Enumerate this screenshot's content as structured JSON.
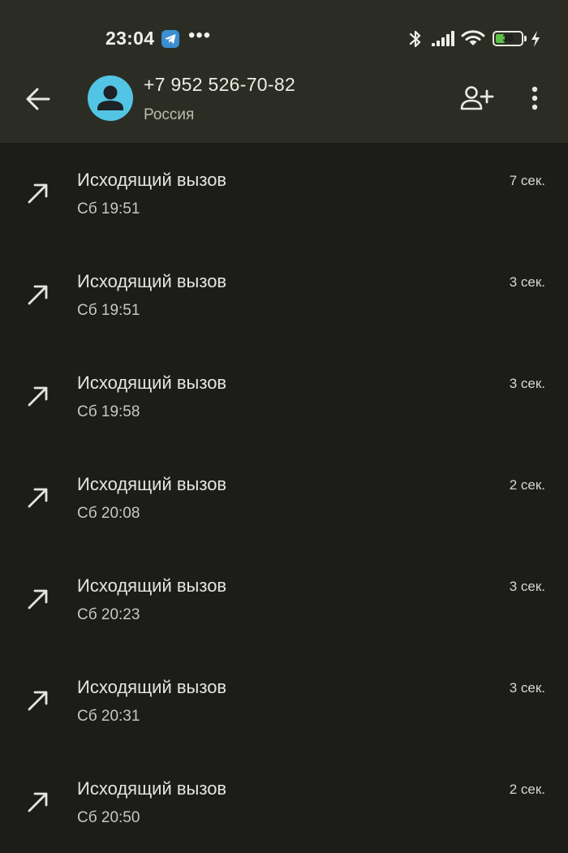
{
  "status_bar": {
    "time": "23:04",
    "more_notifications": "•••",
    "battery_level": "38",
    "battery_fraction": 0.38,
    "icons": [
      "telegram-icon",
      "bluetooth-icon",
      "signal-icon",
      "wifi-icon",
      "battery-icon",
      "charging-icon"
    ]
  },
  "header": {
    "phone_number": "+7 952 526-70-82",
    "region": "Россия",
    "icons": [
      "back-arrow-icon",
      "contact-avatar-icon",
      "add-contact-icon",
      "more-vert-icon"
    ]
  },
  "calls": [
    {
      "type": "Исходящий вызов",
      "time": "Сб 19:51",
      "duration": "7 сек.",
      "icon": "outgoing-call-icon"
    },
    {
      "type": "Исходящий вызов",
      "time": "Сб 19:51",
      "duration": "3 сек.",
      "icon": "outgoing-call-icon"
    },
    {
      "type": "Исходящий вызов",
      "time": "Сб 19:58",
      "duration": "3 сек.",
      "icon": "outgoing-call-icon"
    },
    {
      "type": "Исходящий вызов",
      "time": "Сб 20:08",
      "duration": "2 сек.",
      "icon": "outgoing-call-icon"
    },
    {
      "type": "Исходящий вызов",
      "time": "Сб 20:23",
      "duration": "3 сек.",
      "icon": "outgoing-call-icon"
    },
    {
      "type": "Исходящий вызов",
      "time": "Сб 20:31",
      "duration": "3 сек.",
      "icon": "outgoing-call-icon"
    },
    {
      "type": "Исходящий вызов",
      "time": "Сб 20:50",
      "duration": "2 сек.",
      "icon": "outgoing-call-icon"
    }
  ],
  "colors": {
    "app_bar_background": "#2b2d24",
    "list_background": "#1c1d1a",
    "avatar": "#53c5e4",
    "battery_fill": "#5ec24a"
  }
}
